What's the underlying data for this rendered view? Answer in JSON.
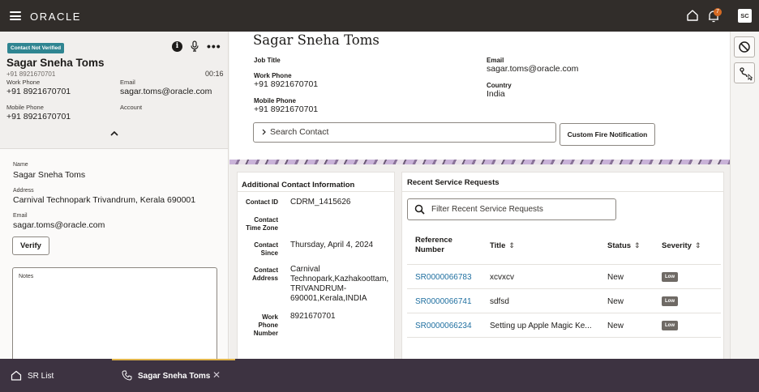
{
  "topbar": {
    "brand": "ORACLE",
    "notification_count": "7",
    "avatar_initials": "SC"
  },
  "contact_panel": {
    "status_badge": "Contact Not Verified",
    "name": "Sagar Sneha Toms",
    "phone_small": "+91 8921670701",
    "call_timer": "00:16",
    "work_phone_label": "Work Phone",
    "work_phone": "+91 8921670701",
    "email_label": "Email",
    "email": "sagar.toms@oracle.com",
    "mobile_phone_label": "Mobile Phone",
    "mobile_phone": "+91 8921670701",
    "account_label": "Account"
  },
  "contact_details": {
    "name_label": "Name",
    "name": "Sagar Sneha Toms",
    "address_label": "Address",
    "address": "Carnival Technopark  Trivandrum, Kerala 690001",
    "email_label": "Email",
    "email": "sagar.toms@oracle.com",
    "verify_label": "Verify",
    "notes_label": "Notes"
  },
  "header": {
    "name": "Sagar Sneha Toms",
    "job_title_label": "Job Title",
    "work_phone_label": "Work Phone",
    "work_phone": "+91 8921670701",
    "mobile_phone_label": "Mobile Phone",
    "mobile_phone": "+91 8921670701",
    "email_label": "Email",
    "email": "sagar.toms@oracle.com",
    "country_label": "Country",
    "country": "India",
    "search_placeholder": "Search Contact",
    "fire_button": "Custom Fire Notification"
  },
  "additional_info": {
    "title": "Additional Contact Information",
    "contact_id_label": "Contact ID",
    "contact_id": "CDRM_1415626",
    "time_zone_label_1": "Contact",
    "time_zone_label_2": "Time Zone",
    "since_label_1": "Contact",
    "since_label_2": "Since",
    "since": "Thursday, April 4, 2024",
    "address_label_1": "Contact",
    "address_label_2": "Address",
    "address_line_1": "Carnival",
    "address_line_2": "Technopark,Kazhakoottam,",
    "address_line_3": "TRIVANDRUM-",
    "address_line_4": "690001,Kerala,INDIA",
    "work_phone_label_1": "Work",
    "work_phone_label_2": "Phone",
    "work_phone_label_3": "Number",
    "work_phone": "8921670701"
  },
  "recent_sr": {
    "title": "Recent Service Requests",
    "filter_placeholder": "Filter Recent Service Requests",
    "columns": {
      "ref_1": "Reference",
      "ref_2": "Number",
      "title": "Title",
      "status": "Status",
      "severity": "Severity"
    },
    "rows": [
      {
        "ref": "SR0000066783",
        "title": "xcvxcv",
        "status": "New",
        "severity": "Low"
      },
      {
        "ref": "SR0000066741",
        "title": "sdfsd",
        "status": "New",
        "severity": "Low"
      },
      {
        "ref": "SR0000066234",
        "title": "Setting up Apple Magic Ke...",
        "status": "New",
        "severity": "Low"
      }
    ]
  },
  "bottom_tabs": {
    "sr_list": "SR List",
    "contact_tab": "Sagar Sneha Toms",
    "close_glyph": "✕"
  }
}
